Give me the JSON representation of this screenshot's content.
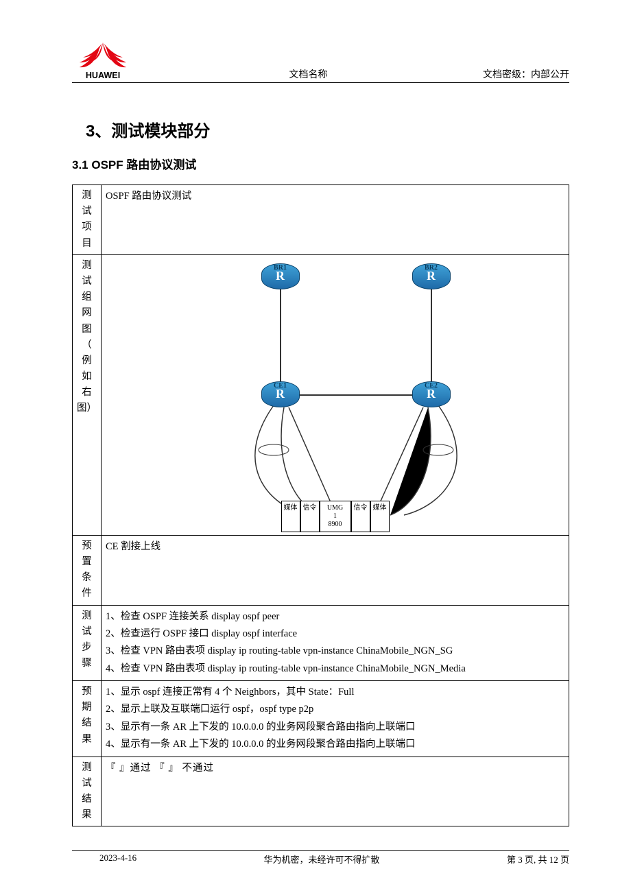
{
  "header": {
    "center": "文档名称",
    "right_label": "文档密级：",
    "right_value": "内部公开",
    "brand": "HUAWEI"
  },
  "section": {
    "title": "3、测试模块部分"
  },
  "subsection": {
    "title": "3.1 OSPF 路由协议测试"
  },
  "table": {
    "row_labels": {
      "item": "测试项目",
      "topology": "测试组网图（例如右图）",
      "precond": "预置条件",
      "steps": "测试步骤",
      "expect": "预期结果",
      "result": "测试结果"
    },
    "item": "OSPF 路由协议测试",
    "precond": "CE 割接上线",
    "steps": [
      "1、检查 OSPF 连接关系    display    ospf    peer",
      "2、检查运行 OSPF 接口    display    ospf    interface",
      "3、检查 VPN 路由表项    display    ip    routing-table    vpn-instance    ChinaMobile_NGN_SG",
      "4、检查 VPN 路由表项    display    ip    routing-table    vpn-instance    ChinaMobile_NGN_Media"
    ],
    "expect": [
      "1、显示 ospf 连接正常有 4 个 Neighbors，其中 State：Full",
      "2、显示上联及互联端口运行 ospf，ospf   type   p2p",
      "3、显示有一条 AR 上下发的 10.0.0.0 的业务网段聚合路由指向上联端口",
      "4、显示有一条 AR 上下发的 10.0.0.0 的业务网段聚合路由指向上联端口"
    ],
    "result": "『 』通过        『 』   不通过"
  },
  "diagram": {
    "routers": {
      "br1": "BR1",
      "br2": "BR2",
      "ce1": "CE1",
      "ce2": "CE2"
    },
    "router_glyph": "R",
    "umg": {
      "media": "媒体",
      "signal": "信令",
      "center_top": "UMG",
      "center_mid": "1",
      "center_bot": "8900"
    }
  },
  "footer": {
    "date": "2023-4-16",
    "center": "华为机密，未经许可不得扩散",
    "right_prefix": "第 ",
    "page_cur": "3",
    "right_mid": " 页, 共 ",
    "page_total": "12",
    "right_suffix": " 页"
  }
}
